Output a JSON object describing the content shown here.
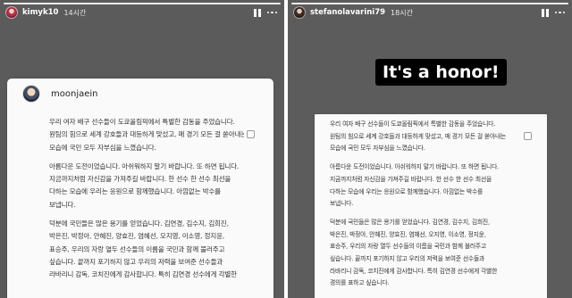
{
  "left_story": {
    "username": "kimyk10",
    "time_ago": "14시간",
    "post": {
      "author": "moonjaein",
      "paragraphs": [
        [
          "우리 여자 배구 선수들이 도쿄올림픽에서 특별한 감동을 주었습니다.",
          "원팀의 힘으로 세계 강호들과 대등하게 맞섰고, 매 경기 모든 걸 쏟아내는",
          "모습에 국민 모두 자부심을 느꼈습니다."
        ],
        [
          "아름다운 도전이었습니다. 아쉬워하지 말기 바랍니다. 또 하면 됩니다.",
          "지금까지처럼 자신감을 가져주길 바랍니다. 한 선수 한 선수 최선을",
          "다하는 모습에 우리는 응원으로 함께했습니다. 아낌없는 박수를",
          "보냅니다."
        ],
        [
          "덕분에 국민들은 많은 용기를 얻었습니다. 김연경, 김수지, 김희진,",
          "박은진, 박정아, 안혜진, 양효진, 염혜선, 오지영, 이소영, 정지윤,",
          "표승주, 우리의 자랑 열두 선수들의 이름을 국민과 함께 불러주고",
          "싶습니다. 끝까지 포기하지 않고 우리의 저력을 보여준 선수들과",
          "라바리니 감독, 코치진에게 감사합니다. 특히 김연경 선수에게 각별한"
        ]
      ]
    }
  },
  "right_story": {
    "username": "stefanolavarini79",
    "time_ago": "18시간",
    "overlay_text": "It's a honor!",
    "post": {
      "paragraphs": [
        [
          "우리 여자 배구 선수들이 도쿄올림픽에서 특별한 감동을 주었습니다.",
          "원팀의 힘으로 세계 강호들과 대등하게 맞섰고, 매 경기 모든 걸 쏟아내는",
          "모습에 국민 모두 자부심을 느꼈습니다."
        ],
        [
          "아름다운 도전이었습니다. 아쉬워하지 말기 바랍니다. 또 하면 됩니다.",
          "지금까지처럼 자신감을 가져주길 바랍니다. 한 선수 한 선수 최선을",
          "다하는 모습에 우리는 응원으로 함께했습니다. 아낌없는 박수를",
          "보냅니다."
        ],
        [
          "덕분에 국민들은 많은 용기를 얻었습니다. 김연경, 김수지, 김희진,",
          "박은진, 박정아, 안혜진, 양효진, 염혜선, 오지영, 이소영, 정지윤,",
          "표승주, 우리의 자랑 열두 선수들의 이름을 국민과 함께 불러주고",
          "싶습니다. 끝까지 포기하지 않고 우리의 저력을 보여준 선수들과",
          "라바리니 감독, 코치진에게 감사합니다. 특히 김연경 선수에게 각별한",
          "경의를 표하고 싶습니다."
        ]
      ]
    }
  },
  "icons": {
    "pause": "pause-icon",
    "more": "more-icon"
  },
  "colors": {
    "story_background": "#5b5b5b",
    "card_background": "#fafafa",
    "overlay_background": "#000000"
  }
}
